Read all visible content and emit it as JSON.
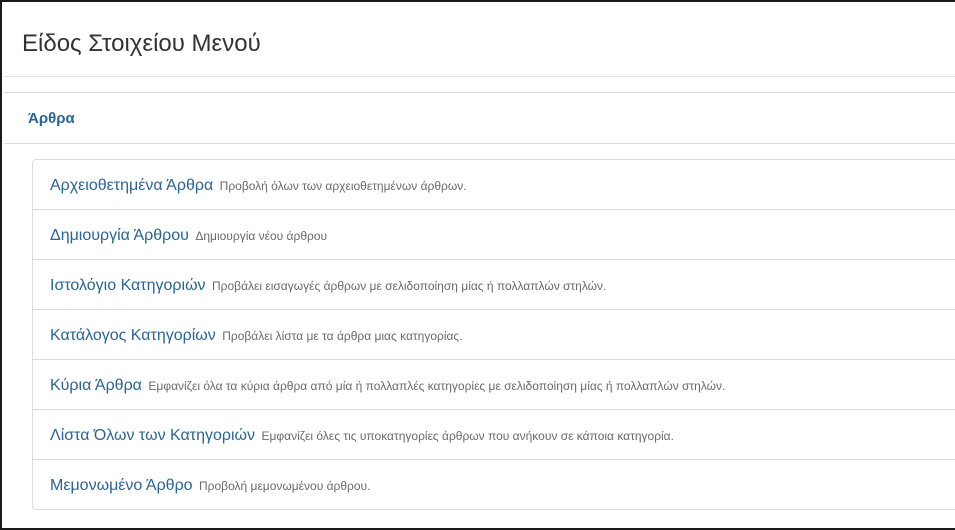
{
  "modal": {
    "title": "Είδος Στοιχείου Μενού"
  },
  "panel": {
    "heading": "Άρθρα",
    "items": [
      {
        "title": "Αρχειοθετημένα Άρθρα",
        "description": "Προβολή όλων των αρχειοθετημένων άρθρων."
      },
      {
        "title": "Δημιουργία Άρθρου",
        "description": "Δημιουργία νέου άρθρου"
      },
      {
        "title": "Ιστολόγιο Κατηγοριών",
        "description": "Προβάλει εισαγωγές άρθρων με σελιδοποίηση μίας ή πολλαπλών στηλών."
      },
      {
        "title": "Κατάλογος Κατηγορίων",
        "description": "Προβάλει λίστα με τα άρθρα μιας κατηγορίας."
      },
      {
        "title": "Κύρια Άρθρα",
        "description": "Εμφανίζει όλα τα κύρια άρθρα από μία ή πολλαπλές κατηγορίες με σελιδοποίηση μίας ή πολλαπλών στηλών."
      },
      {
        "title": "Λίστα Όλων των Κατηγοριών",
        "description": "Εμφανίζει όλες τις υποκατηγορίες άρθρων που ανήκουν σε κάποια κατηγορία."
      },
      {
        "title": "Μεμονωμένο Άρθρο",
        "description": "Προβολή μεμονωμένου άρθρου."
      }
    ]
  }
}
